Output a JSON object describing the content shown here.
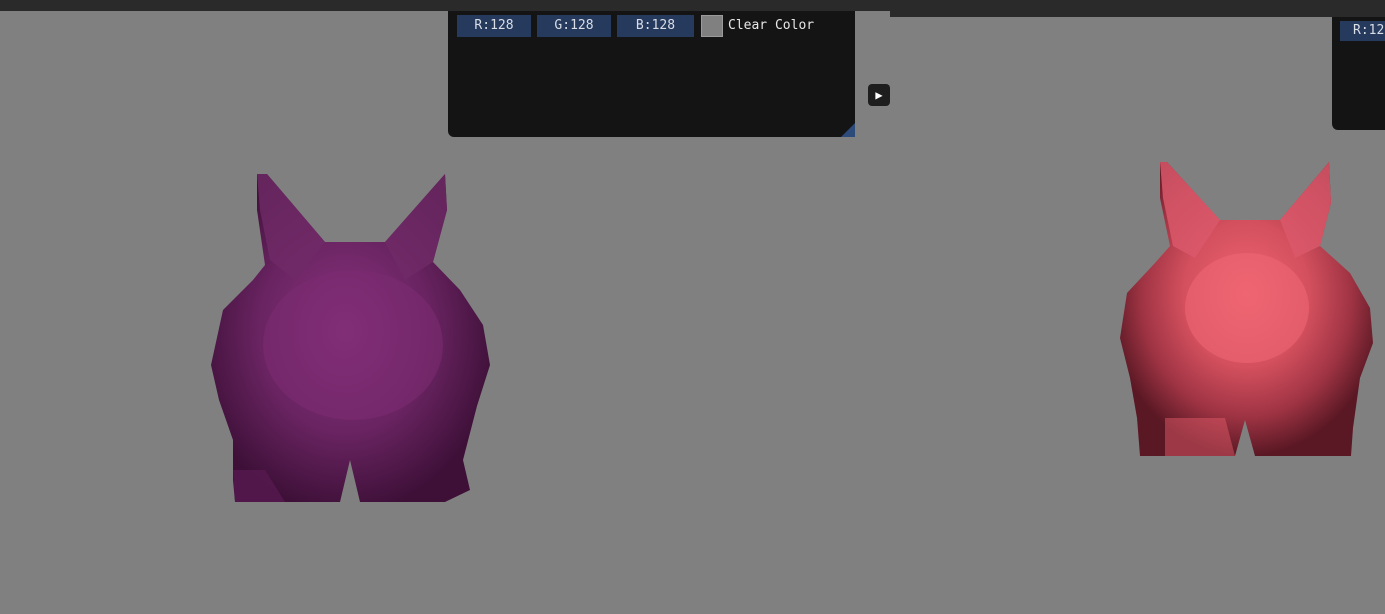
{
  "top_panel": {
    "r_value": "R:128",
    "g_value": "G:128",
    "b_value": "B:128",
    "swatch_color": "#808080",
    "clear_color_label": "Clear Color"
  },
  "right_panel": {
    "r_value_partial": "R:12"
  },
  "play_button": {
    "glyph": "▶"
  },
  "background_color": "#808080",
  "bunny_left": {
    "tint": "#7a2a6e",
    "shade": "#4a1440"
  },
  "bunny_right": {
    "tint": "#e05868",
    "shade": "#7a2030"
  }
}
